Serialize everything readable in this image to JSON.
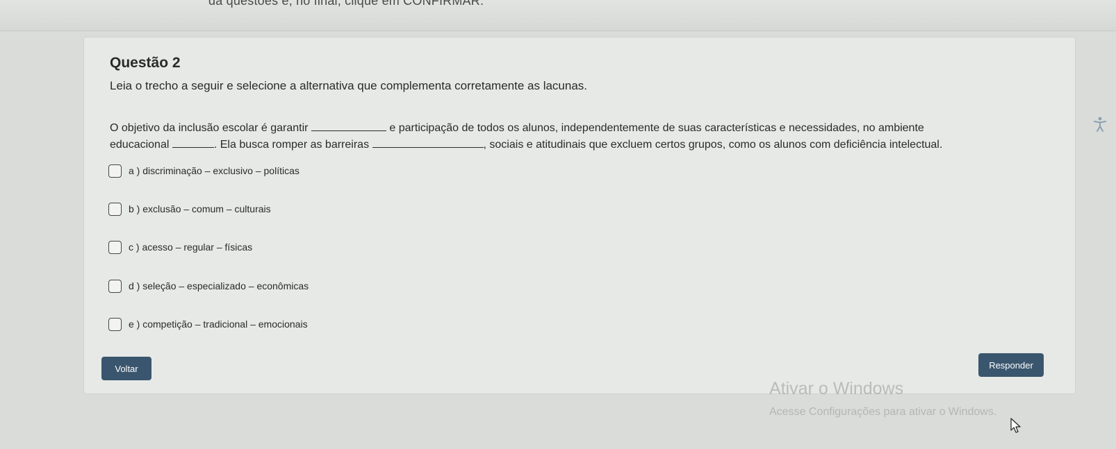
{
  "top_instruction": "da questões e, no final, clique em CONFIRMAR.",
  "question": {
    "title": "Questão 2",
    "instruction": "Leia o trecho a seguir e selecione a alternativa que complementa corretamente as lacunas.",
    "passage": {
      "line1_part1": "O objetivo da inclusão escolar é garantir",
      "line1_part2": "e participação de todos os alunos, independentemente de suas características e necessidades, no ambiente",
      "line2_part1": "educacional",
      "line2_part2": ". Ela busca romper as barreiras",
      "line2_part3": ", sociais e atitudinais que excluem certos grupos, como os alunos com deficiência intelectual."
    },
    "options": [
      {
        "label": "a ) discriminação – exclusivo – políticas"
      },
      {
        "label": "b ) exclusão – comum – culturais"
      },
      {
        "label": "c ) acesso – regular – físicas"
      },
      {
        "label": "d ) seleção – especializado – econômicas"
      },
      {
        "label": "e ) competição – tradicional – emocionais"
      }
    ]
  },
  "buttons": {
    "back_label": "Voltar",
    "answer_label": "Responder"
  },
  "watermark": {
    "title": "Ativar o Windows",
    "subtitle": "Acesse Configurações para ativar o Windows."
  },
  "colors": {
    "button_bg": "#3a566e",
    "card_bg": "#e7e9e6",
    "page_bg": "#d9dcd8"
  },
  "icons": {
    "side_icon": "accessibility-icon",
    "cursor": "mouse-pointer-icon"
  }
}
